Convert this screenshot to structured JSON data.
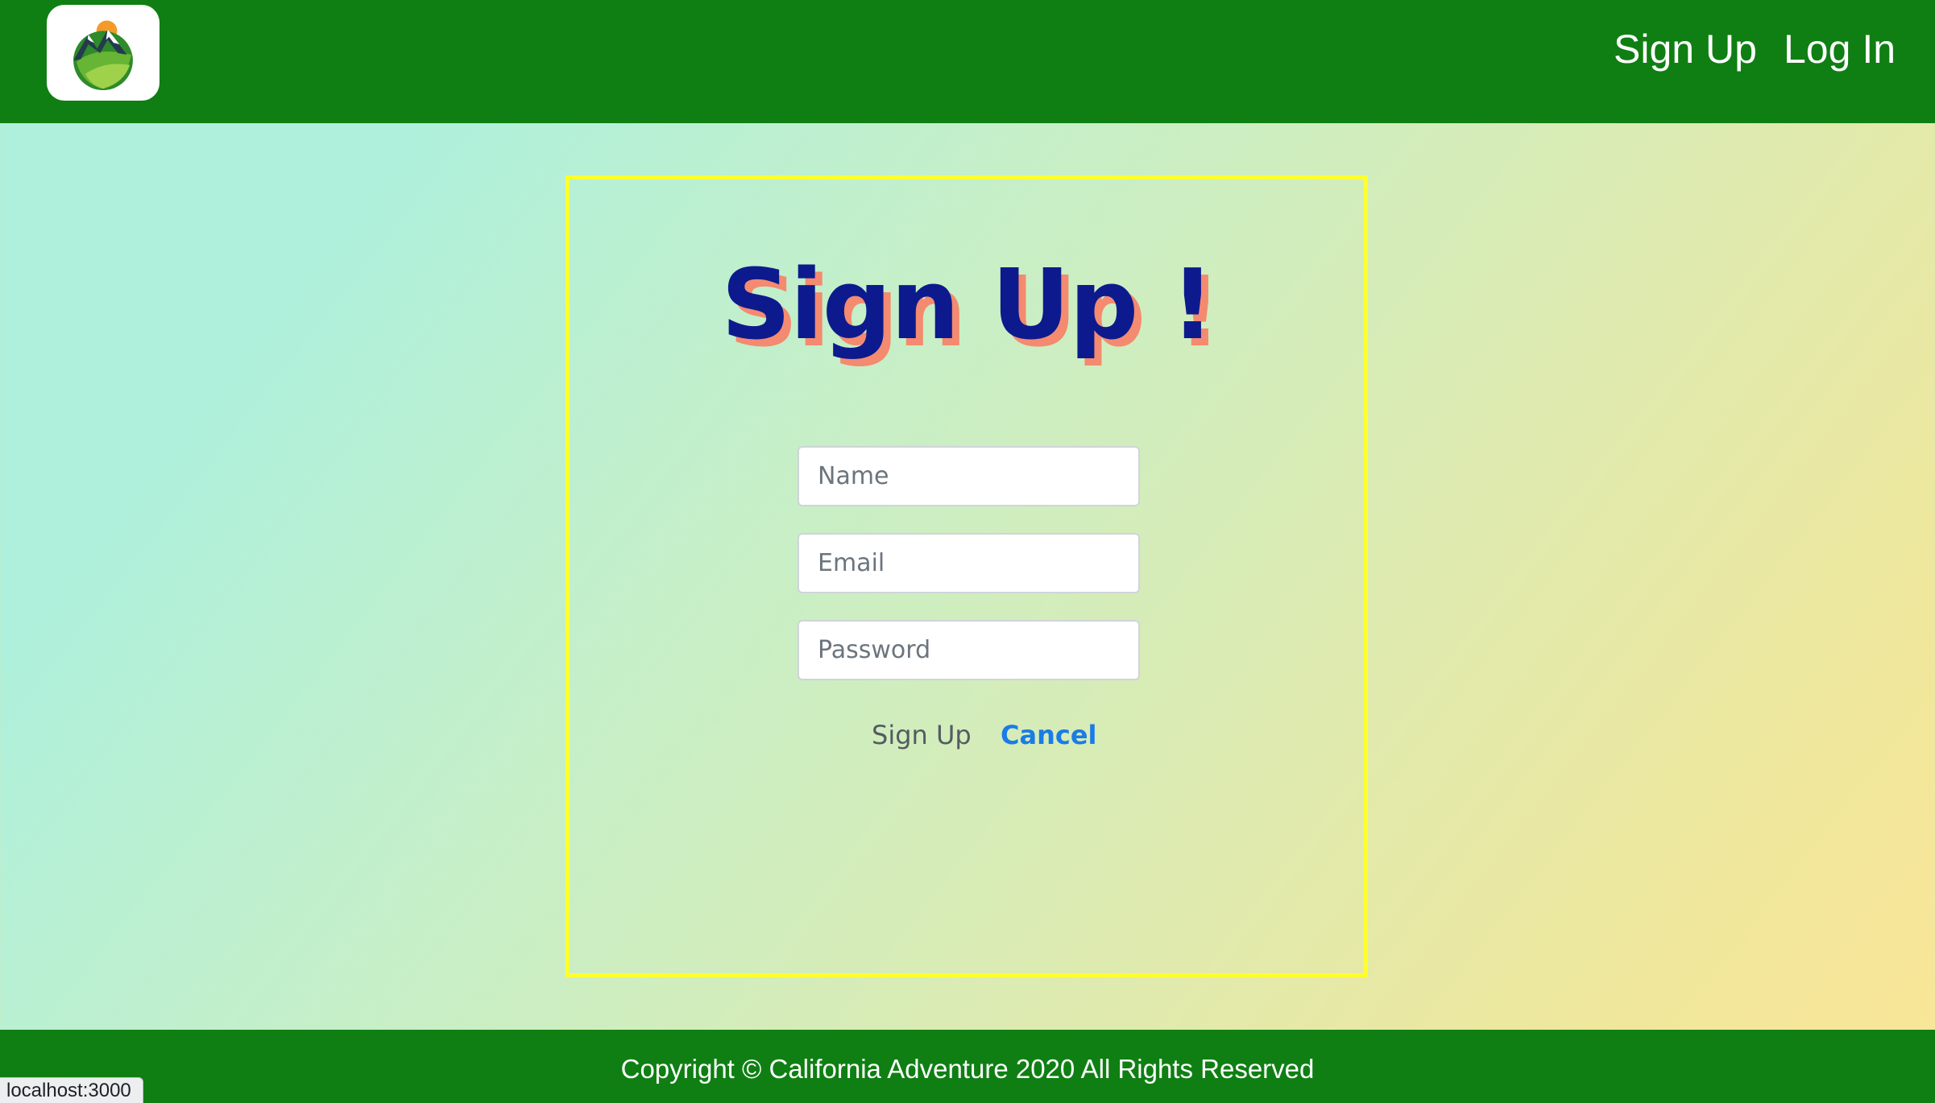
{
  "header": {
    "logo": {
      "icon": "mountain-sun-logo-icon"
    },
    "nav": {
      "signup_label": "Sign Up",
      "login_label": "Log In"
    }
  },
  "form": {
    "title": "Sign Up !",
    "fields": [
      {
        "name": "name",
        "placeholder": "Name",
        "value": ""
      },
      {
        "name": "email",
        "placeholder": "Email",
        "value": ""
      },
      {
        "name": "password",
        "placeholder": "Password",
        "value": ""
      }
    ],
    "submit_label": "Sign Up",
    "cancel_label": "Cancel"
  },
  "footer": {
    "copyright": "Copyright © California Adventure 2020 All Rights Reserved"
  },
  "status_bar": {
    "url": "localhost:3000"
  },
  "colors": {
    "header_bg": "#0f7f13",
    "card_border": "#ffff2e",
    "title_text": "#0c1a8e",
    "title_shadow": "#f48a6f",
    "cancel_link": "#1a7ce6",
    "gradient_start": "#aef0dc",
    "gradient_end": "#fbe697"
  }
}
